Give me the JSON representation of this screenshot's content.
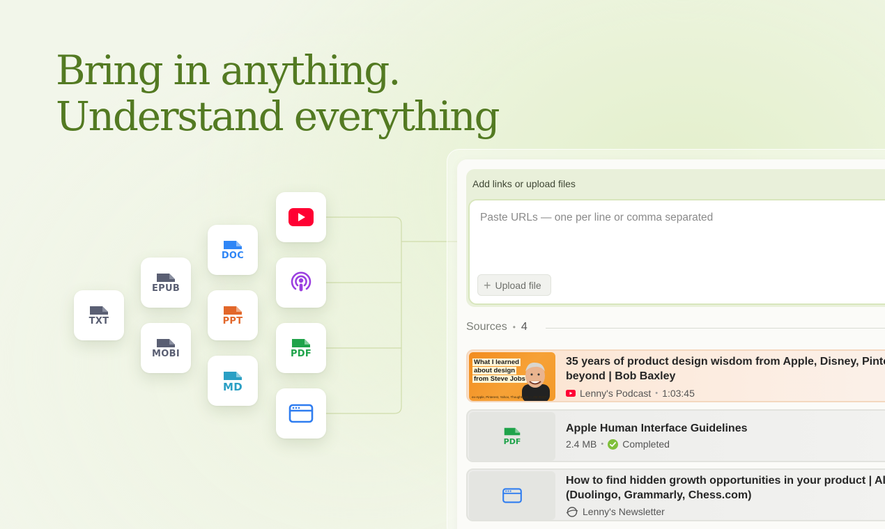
{
  "headline": "Bring in anything. Understand everything",
  "file_types": {
    "txt": "TXT",
    "epub": "EPUB",
    "mobi": "MOBI",
    "doc": "DOC",
    "ppt": "PPT",
    "md": "MD",
    "pdf": "PDF"
  },
  "add_sources": {
    "label": "Add links or upload files",
    "placeholder": "Paste URLs — one per line or comma separated",
    "upload_button": "Upload file"
  },
  "sources": {
    "label": "Sources",
    "count": "4",
    "items": [
      {
        "title_line1": "35 years of product design wisdom from Apple, Disney, Pinte",
        "title_line2": "beyond | Bob Baxley",
        "source": "Lenny's Podcast",
        "duration": "1:03:45",
        "thumb_text_a": "What I learned",
        "thumb_text_b": "about design",
        "thumb_text_c": "from Steve Jobs",
        "thumb_caption": "ex-Apple, Pinterest, Yahoo, ThoughtSpot — #M #M2P"
      },
      {
        "title_line1": "Apple Human Interface Guidelines",
        "size": "2.4 MB",
        "status": "Completed",
        "file_label": "PDF"
      },
      {
        "title_line1": "How to find hidden growth opportunities in your product | Al",
        "title_line2": "(Duolingo, Grammarly, Chess.com)",
        "source": "Lenny's Newsletter"
      }
    ]
  },
  "colors": {
    "headline": "#537a22",
    "youtube": "#ff0033",
    "podcast": "#9b3fe0",
    "pdf": "#1fa34a",
    "doc": "#2f86f6",
    "ppt": "#e2672a",
    "md": "#2a9fc4",
    "generic_file": "#5a5f73",
    "completed": "#7fbf3a"
  }
}
